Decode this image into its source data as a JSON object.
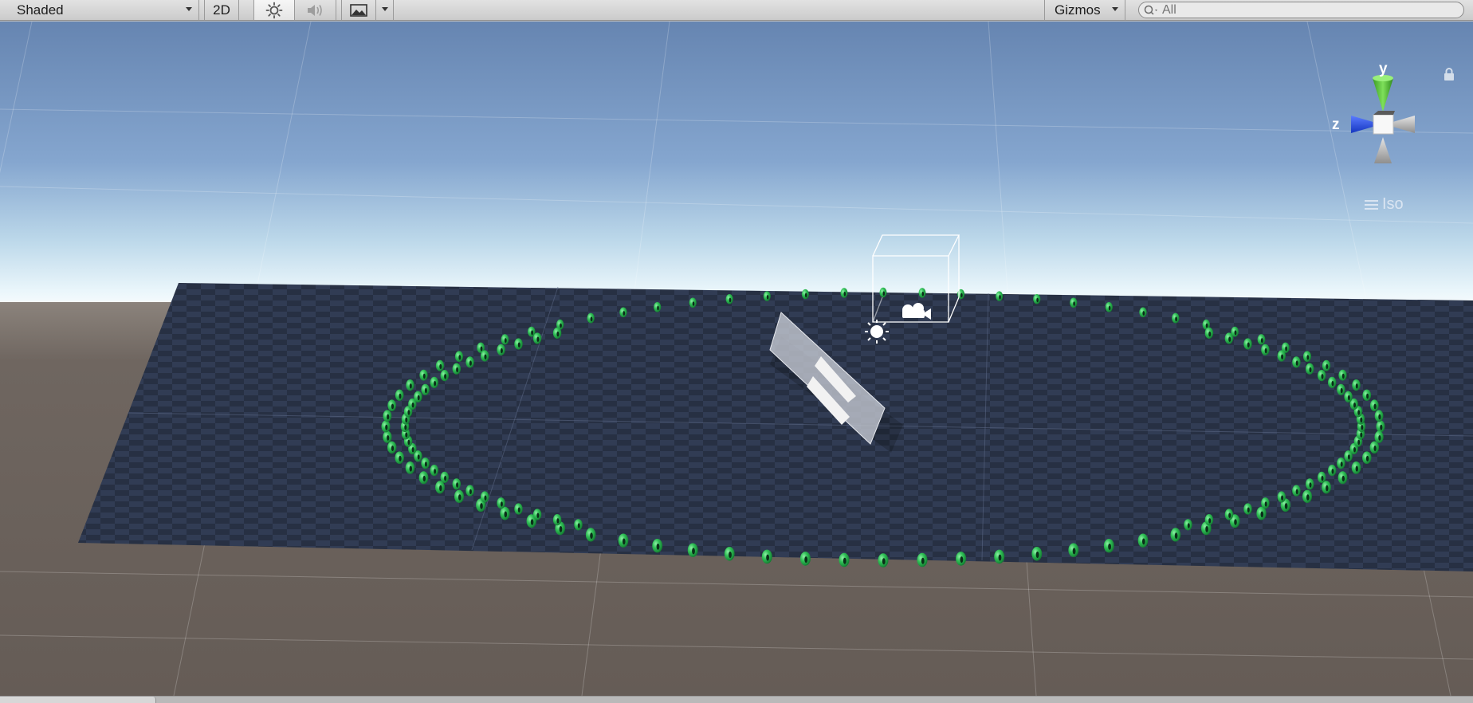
{
  "toolbar": {
    "draw_mode": "Shaded",
    "mode_2d": "2D",
    "lighting_icon": "sun-icon",
    "audio_icon": "speaker-icon",
    "effects_icon": "landscape-image-icon",
    "gizmos_label": "Gizmos",
    "search_placeholder": "All"
  },
  "scene_gizmo": {
    "y_label": "y",
    "z_label": "z",
    "projection_label": "Iso",
    "colors": {
      "y": "#5fd13a",
      "z": "#2f55e8",
      "neutral": "#b8b8b8"
    }
  },
  "scene": {
    "sky_top": "#6d8ab4",
    "horizon": "#eaf6fb",
    "ground": "#6c635d",
    "plane": "#333d50",
    "ring_color": "#27b84a",
    "objects": [
      "directional-light",
      "camera",
      "canvas-panel",
      "ring-of-spheres",
      "checker-plane"
    ]
  }
}
